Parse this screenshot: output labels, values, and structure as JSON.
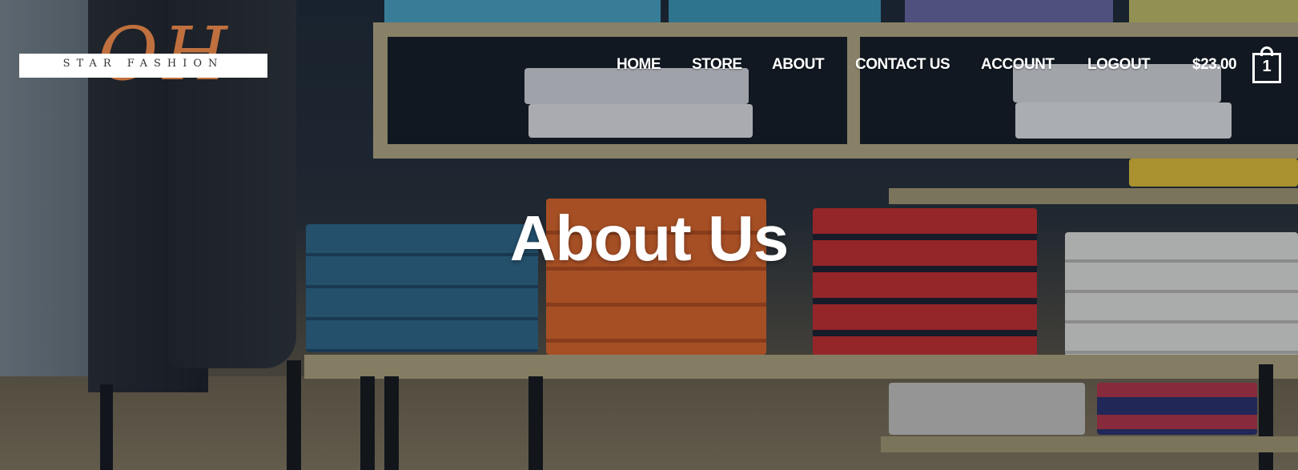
{
  "brand": {
    "monogram": "OH",
    "name": "STAR FASHION"
  },
  "nav": {
    "items": [
      {
        "label": "HOME"
      },
      {
        "label": "STORE"
      },
      {
        "label": "ABOUT"
      },
      {
        "label": "CONTACT US"
      },
      {
        "label": "ACCOUNT"
      },
      {
        "label": "LOGOUT"
      }
    ],
    "cart_total": "$23.00",
    "cart_count": "1"
  },
  "hero": {
    "title": "About Us"
  },
  "colors": {
    "nav_text": "#ffffff",
    "logo_accent": "#c0703e",
    "shelf_wood": "#b9ae86"
  },
  "icons": {
    "cart": "shopping-bag-icon"
  }
}
